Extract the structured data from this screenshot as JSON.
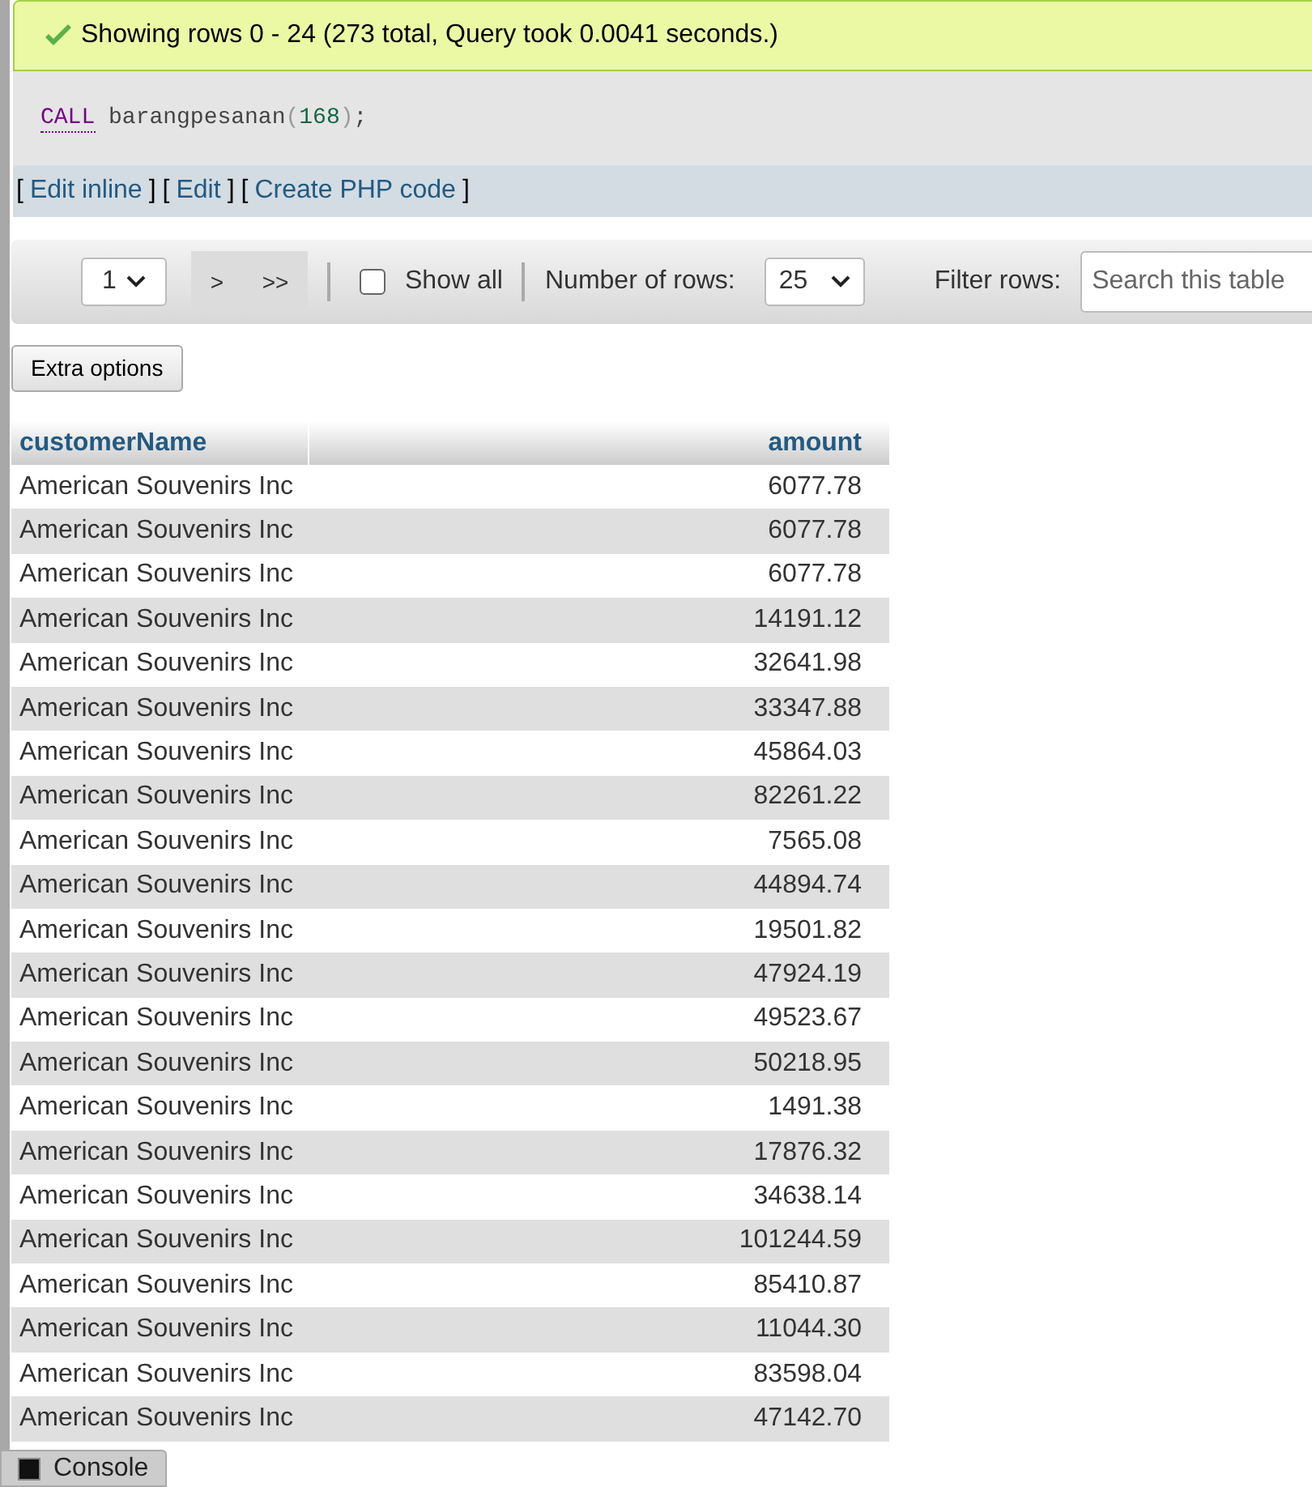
{
  "message": {
    "text": "Showing rows 0 - 24 (273 total, Query took 0.0041 seconds.)"
  },
  "query": {
    "keyword": "CALL",
    "name": "barangpesanan",
    "open": "(",
    "arg": "168",
    "close": ");"
  },
  "query_links": [
    {
      "open": "[",
      "label": "Edit inline",
      "close": "]"
    },
    {
      "open": "[",
      "label": "Edit",
      "close": "]"
    },
    {
      "open": "[",
      "label": "Create PHP code",
      "close": "]"
    }
  ],
  "navigation": {
    "page": "1",
    "next": ">",
    "last": ">>",
    "show_all": {
      "label": "Show all",
      "checked": false
    },
    "rows_label": "Number of rows:",
    "rows": "25",
    "filter_label": "Filter rows:",
    "filter_placeholder": "Search this table"
  },
  "extra_options": "Extra options",
  "table": {
    "columns": [
      "customerName",
      "amount"
    ],
    "rows": [
      [
        "American Souvenirs Inc",
        "6077.78"
      ],
      [
        "American Souvenirs Inc",
        "6077.78"
      ],
      [
        "American Souvenirs Inc",
        "6077.78"
      ],
      [
        "American Souvenirs Inc",
        "14191.12"
      ],
      [
        "American Souvenirs Inc",
        "32641.98"
      ],
      [
        "American Souvenirs Inc",
        "33347.88"
      ],
      [
        "American Souvenirs Inc",
        "45864.03"
      ],
      [
        "American Souvenirs Inc",
        "82261.22"
      ],
      [
        "American Souvenirs Inc",
        "7565.08"
      ],
      [
        "American Souvenirs Inc",
        "44894.74"
      ],
      [
        "American Souvenirs Inc",
        "19501.82"
      ],
      [
        "American Souvenirs Inc",
        "47924.19"
      ],
      [
        "American Souvenirs Inc",
        "49523.67"
      ],
      [
        "American Souvenirs Inc",
        "50218.95"
      ],
      [
        "American Souvenirs Inc",
        "1491.38"
      ],
      [
        "American Souvenirs Inc",
        "17876.32"
      ],
      [
        "American Souvenirs Inc",
        "34638.14"
      ],
      [
        "American Souvenirs Inc",
        "101244.59"
      ],
      [
        "American Souvenirs Inc",
        "85410.87"
      ],
      [
        "American Souvenirs Inc",
        "11044.30"
      ],
      [
        "American Souvenirs Inc",
        "83598.04"
      ],
      [
        "American Souvenirs Inc",
        "47142.70"
      ]
    ]
  },
  "console": {
    "label": "Console"
  }
}
